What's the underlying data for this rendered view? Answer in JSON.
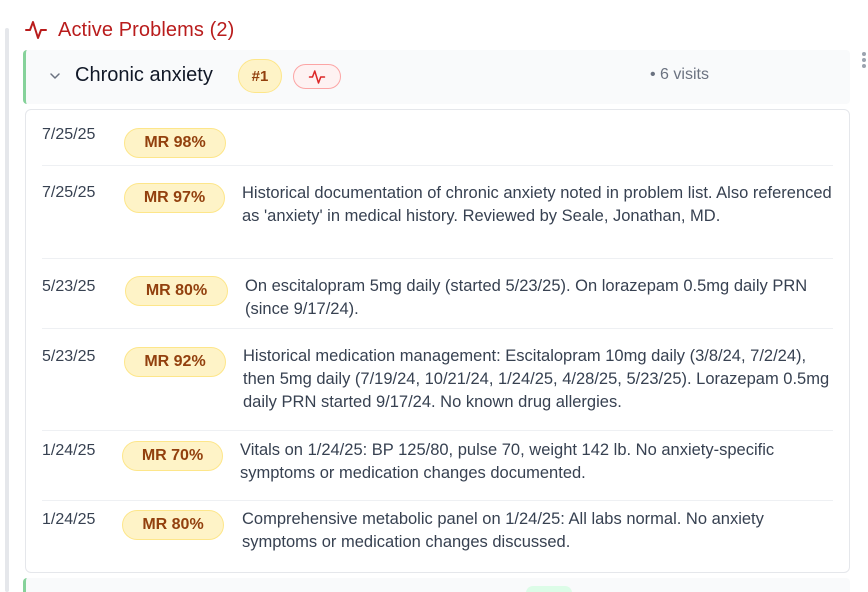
{
  "section": {
    "title": "Active Problems (2)",
    "icon": "activity-icon",
    "accent": "#b91c1c"
  },
  "problem": {
    "name": "Chronic anxiety",
    "rank": "#1",
    "visits": "• 6 visits"
  },
  "entries": [
    {
      "date": "7/25/25",
      "mr": "MR 98%",
      "note": ""
    },
    {
      "date": "7/25/25",
      "mr": "MR 97%",
      "note": "Historical documentation of chronic anxiety noted in problem list. Also referenced as 'anxiety' in medical history. Reviewed by Seale, Jonathan, MD."
    },
    {
      "date": "5/23/25",
      "mr": "MR 80%",
      "note": "On escitalopram 5mg daily (started 5/23/25). On lorazepam 0.5mg daily PRN (since 9/17/24)."
    },
    {
      "date": "5/23/25",
      "mr": "MR 92%",
      "note": "Historical medication management: Escitalopram 10mg daily (3/8/24, 7/2/24), then 5mg daily (7/19/24, 10/21/24, 1/24/25, 4/28/25, 5/23/25). Lorazepam 0.5mg daily PRN started 9/17/24. No known drug allergies."
    },
    {
      "date": "1/24/25",
      "mr": "MR 70%",
      "note": "Vitals on 1/24/25: BP 125/80, pulse 70, weight 142 lb. No anxiety-specific symptoms or medication changes documented."
    },
    {
      "date": "1/24/25",
      "mr": "MR 80%",
      "note": "Comprehensive metabolic panel on 1/24/25: All labs normal. No anxiety symptoms or medication changes discussed."
    }
  ]
}
